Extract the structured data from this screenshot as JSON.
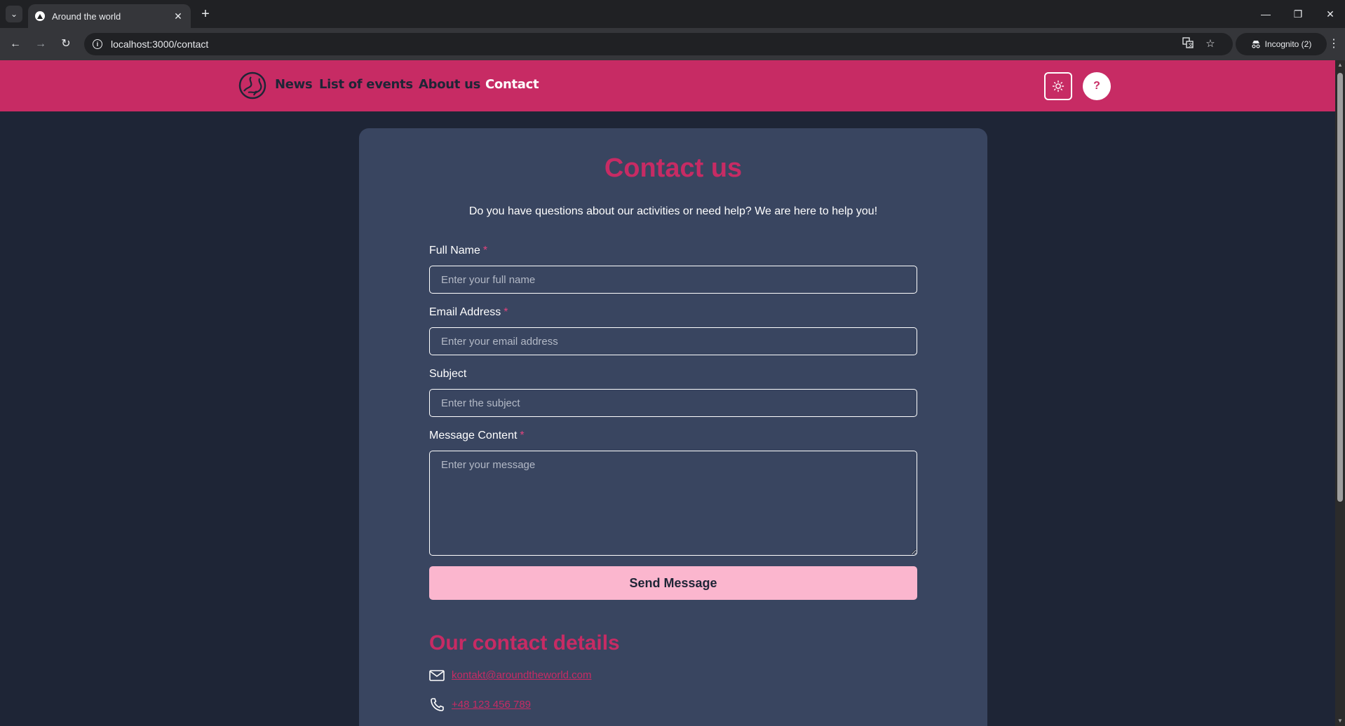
{
  "browser": {
    "tab_title": "Around the world",
    "url": "localhost:3000/contact",
    "incognito_label": "Incognito (2)",
    "icons": [
      "tab-list-icon",
      "close-icon",
      "plus-icon",
      "minimize-icon",
      "restore-icon",
      "close-window-icon",
      "back-icon",
      "forward-icon",
      "reload-icon",
      "info-icon",
      "translate-icon",
      "star-icon",
      "incognito-icon",
      "kebab-menu-icon"
    ]
  },
  "header": {
    "nav": [
      "News",
      "List of events",
      "About us",
      "Contact"
    ],
    "active": "Contact",
    "help_label": "?",
    "icons": [
      "globe-logo-icon",
      "sun-icon"
    ]
  },
  "contact": {
    "title": "Contact us",
    "subtitle": "Do you have questions about our activities or need help? We are here to help you!",
    "fields": {
      "full_name": {
        "label": "Full Name",
        "required": "*",
        "placeholder": "Enter your full name"
      },
      "email": {
        "label": "Email Address",
        "required": "*",
        "placeholder": "Enter your email address"
      },
      "subject": {
        "label": "Subject",
        "placeholder": "Enter the subject"
      },
      "message": {
        "label": "Message Content",
        "required": "*",
        "placeholder": "Enter your message"
      }
    },
    "send_label": "Send Message",
    "details_title": "Our contact details",
    "email_link": "kontakt@aroundtheworld.com",
    "phone_link": "+48 123 456 789"
  },
  "colors": {
    "page_bg": "#1e2536",
    "card_bg": "#394560",
    "brand_pink": "#c72b64",
    "button_pink": "#fbb6ce"
  }
}
